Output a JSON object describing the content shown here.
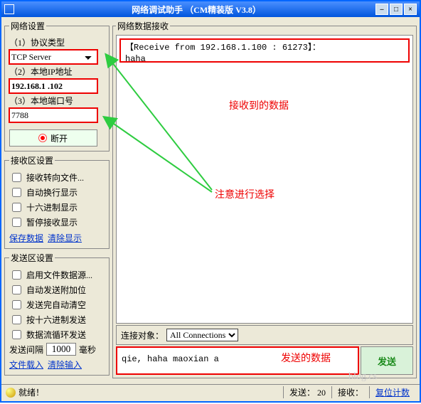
{
  "window": {
    "title": "网络调试助手 （CM精装版 V3.8）"
  },
  "net_settings": {
    "legend": "网络设置",
    "protocol_label": "（1）协议类型",
    "protocol_value": "TCP Server",
    "ip_label": "（2）本地IP地址",
    "ip_value": "192.168.1 .102",
    "port_label": "（3）本地端口号",
    "port_value": "7788",
    "disconnect_label": "断开"
  },
  "recv_settings": {
    "legend": "接收区设置",
    "to_file": "接收转向文件...",
    "auto_wrap": "自动换行显示",
    "hex": "十六进制显示",
    "pause": "暂停接收显示",
    "save_link": "保存数据",
    "clear_link": "清除显示"
  },
  "send_settings": {
    "legend": "发送区设置",
    "file_src": "启用文件数据源...",
    "auto_append": "自动发送附加位",
    "auto_clear": "发送完自动清空",
    "hex_send": "按十六进制发送",
    "loop_send": "数据流循环发送",
    "interval_label": "发送间隔",
    "interval_value": "1000",
    "interval_unit": "毫秒",
    "file_link": "文件载入",
    "clear_link": "清除输入"
  },
  "recv_area": {
    "legend": "网络数据接收",
    "line1": "【Receive from 192.168.1.100 : 61273】：",
    "line2": "haha"
  },
  "bottom": {
    "target_label": "连接对象：",
    "target_value": "All Connections"
  },
  "send_area": {
    "text": "qie, haha maoxian a",
    "button": "发送"
  },
  "status": {
    "ready": "就绪！",
    "send_label": "发送：",
    "send_count": "20",
    "recv_label": "接收：",
    "recv_count": "复位计数"
  },
  "annotations": {
    "received": "接收到的数据",
    "select_hint": "注意进行选择",
    "sent": "发送的数据"
  }
}
